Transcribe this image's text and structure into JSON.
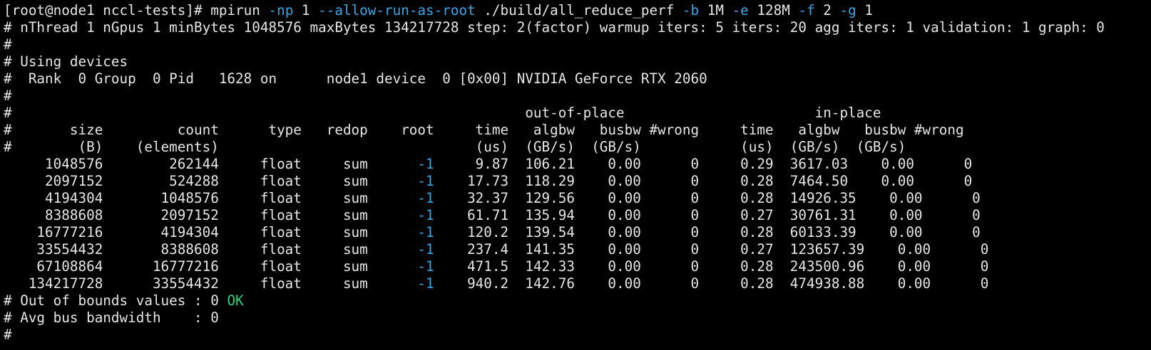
{
  "colors": {
    "background": "#000000",
    "foreground": "#e6e6e6",
    "flag": "#3aa7e6",
    "root_value": "#3aa7e6",
    "ok": "#2bd47e"
  },
  "command_line": {
    "prompt": "[root@node1 nccl-tests]# ",
    "program": "mpirun",
    "np_flag": "-np",
    "np_value": "1",
    "allow_root_flag": "--allow-run-as-root",
    "binary": "./build/all_reduce_perf",
    "b_flag": "-b",
    "b_value": "1M",
    "e_flag": "-e",
    "e_value": "128M",
    "f_flag": "-f",
    "f_value": "2",
    "g_flag": "-g",
    "g_value": "1"
  },
  "header_lines": [
    "# nThread 1 nGpus 1 minBytes 1048576 maxBytes 134217728 step: 2(factor) warmup iters: 5 iters: 20 agg iters: 1 validation: 1 graph: 0",
    "#",
    "# Using devices",
    "#  Rank  0 Group  0 Pid   1628 on      node1 device  0 [0x00] NVIDIA GeForce RTX 2060",
    "#",
    "#                                                              out-of-place                       in-place",
    "#       size         count      type   redop    root     time   algbw   busbw #wrong     time   algbw   busbw #wrong",
    "#        (B)    (elements)                               (us)  (GB/s)  (GB/s)            (us)  (GB/s)  (GB/s)"
  ],
  "rows": [
    {
      "pre": "     1048576        262144     float     sum      ",
      "root": "-1",
      "post": "     9.87  106.21    0.00      0     0.29  3617.03    0.00      0"
    },
    {
      "pre": "     2097152        524288     float     sum      ",
      "root": "-1",
      "post": "    17.73  118.29    0.00      0     0.28  7464.50    0.00      0"
    },
    {
      "pre": "     4194304       1048576     float     sum      ",
      "root": "-1",
      "post": "    32.37  129.56    0.00      0     0.28  14926.35    0.00      0"
    },
    {
      "pre": "     8388608       2097152     float     sum      ",
      "root": "-1",
      "post": "    61.71  135.94    0.00      0     0.27  30761.31    0.00      0"
    },
    {
      "pre": "    16777216       4194304     float     sum      ",
      "root": "-1",
      "post": "    120.2  139.54    0.00      0     0.28  60133.39    0.00      0"
    },
    {
      "pre": "    33554432       8388608     float     sum      ",
      "root": "-1",
      "post": "    237.4  141.35    0.00      0     0.27  123657.39    0.00      0"
    },
    {
      "pre": "    67108864      16777216     float     sum      ",
      "root": "-1",
      "post": "    471.5  142.33    0.00      0     0.28  243500.96    0.00      0"
    },
    {
      "pre": "   134217728      33554432     float     sum      ",
      "root": "-1",
      "post": "    940.2  142.76    0.00      0     0.28  474938.88    0.00      0"
    }
  ],
  "footer": {
    "out_of_bounds_prefix": "# Out of bounds values : 0 ",
    "ok_text": "OK",
    "avg_bus_bandwidth": "# Avg bus bandwidth    : 0",
    "last_line": "#"
  }
}
